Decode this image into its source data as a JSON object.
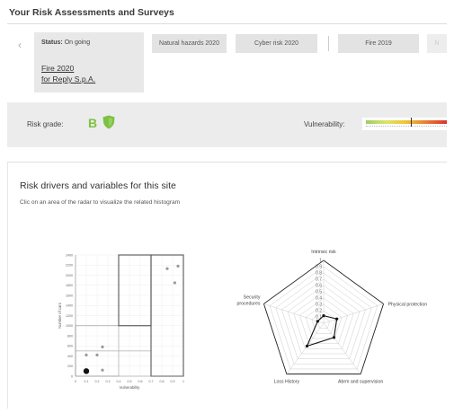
{
  "page": {
    "title": "Your Risk Assessments and Surveys"
  },
  "nav": {
    "prev_icon": "chevron-left-icon"
  },
  "active_assessment": {
    "status_label": "Status:",
    "status_value": "On going",
    "name_line1": "Fire 2020",
    "name_line2": "for Reply S.p.A."
  },
  "tabs": [
    {
      "label": "Natural hazards 2020"
    },
    {
      "label": "Cyber risk 2020"
    },
    {
      "label": "Fire 2019"
    },
    {
      "label": "N"
    }
  ],
  "risk": {
    "label": "Risk grade:",
    "grade": "B",
    "grade_color": "#7dc142",
    "vulnerability_label": "Vulnerability:",
    "vulnerability_level": 0.55
  },
  "drivers": {
    "title": "Risk drivers and variables for this site",
    "subtitle": "Clic on an area of the radar to visualize the related histogram"
  },
  "chart_data": [
    {
      "type": "scatter",
      "xlabel": "Vulnerability",
      "ylabel": "Number of cars",
      "xlim": [
        0,
        1
      ],
      "ylim": [
        0,
        2400
      ],
      "x_ticks": [
        "0",
        "0.1",
        "0.2",
        "0.3",
        "0.4",
        "0.5",
        "0.6",
        "0.7",
        "0.8",
        "0.9",
        "1"
      ],
      "y_ticks": [
        "0",
        "200",
        "400",
        "600",
        "800",
        "1000",
        "1200",
        "1400",
        "1600",
        "1800",
        "2000",
        "2200",
        "2400"
      ],
      "points": [
        {
          "x": 0.1,
          "y": 100,
          "size": "large"
        },
        {
          "x": 0.1,
          "y": 420,
          "size": "small"
        },
        {
          "x": 0.2,
          "y": 420,
          "size": "small"
        },
        {
          "x": 0.25,
          "y": 580,
          "size": "small"
        },
        {
          "x": 0.25,
          "y": 120,
          "size": "small"
        },
        {
          "x": 0.85,
          "y": 2130,
          "size": "small"
        },
        {
          "x": 0.95,
          "y": 2180,
          "size": "small"
        },
        {
          "x": 0.92,
          "y": 1850,
          "size": "small"
        }
      ],
      "regions": [
        {
          "x0": 0.0,
          "x1": 0.4,
          "y0": 0,
          "y1": 1000,
          "style": "light"
        },
        {
          "x0": 0.0,
          "x1": 0.7,
          "y0": 500,
          "y1": 1000,
          "style": "light"
        },
        {
          "x0": 0.4,
          "x1": 0.7,
          "y0": 1000,
          "y1": 2400,
          "style": "dark"
        },
        {
          "x0": 0.7,
          "x1": 1.0,
          "y0": 0,
          "y1": 2400,
          "style": "dark"
        }
      ]
    },
    {
      "type": "radar",
      "axes": [
        "Intrinsic risk",
        "Physical protection",
        "Abrm and supervision",
        "Loss History",
        "Security procedures"
      ],
      "scale_labels": [
        "0.1",
        "0.2",
        "0.3",
        "0.4",
        "0.5",
        "0.6",
        "0.7",
        "0.8",
        "0.9",
        "1"
      ],
      "values": [
        0.12,
        0.22,
        0.28,
        0.45,
        0.1
      ]
    }
  ]
}
